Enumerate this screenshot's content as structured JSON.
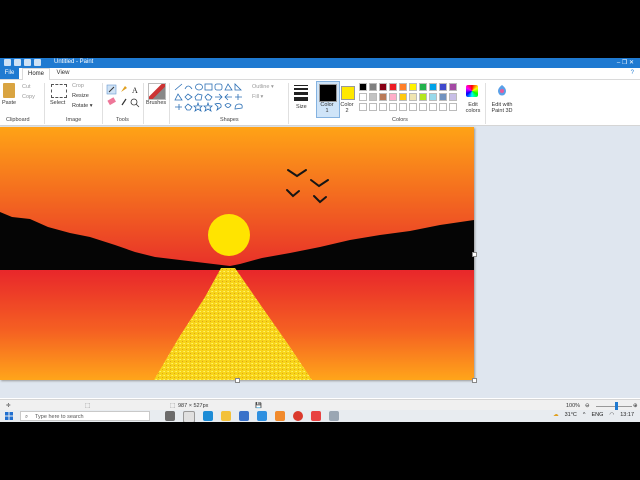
{
  "window": {
    "title": "Untitled - Paint",
    "controls": "–   ❐   ✕"
  },
  "tabs": {
    "file": "File",
    "home": "Home",
    "view": "View"
  },
  "ribbon": {
    "clipboard": {
      "paste": "Paste",
      "cut": "Cut",
      "copy": "Copy",
      "label": "Clipboard"
    },
    "image": {
      "select": "Select",
      "crop": "Crop",
      "resize": "Resize",
      "rotate": "Rotate ▾",
      "label": "Image"
    },
    "tools": {
      "label": "Tools"
    },
    "brushes": {
      "label": "Brushes"
    },
    "shapes": {
      "outline": "Outline ▾",
      "fill": "Fill ▾",
      "label": "Shapes"
    },
    "size": {
      "label": "Size"
    },
    "color1": {
      "label": "Color 1",
      "value": "#000000"
    },
    "color2": {
      "label": "Color 2",
      "value": "#ffe800"
    },
    "colors": {
      "label": "Colors",
      "edit": "Edit colors",
      "paint3d": "Edit with Paint 3D"
    },
    "palette": [
      "#000000",
      "#7f7f7f",
      "#880015",
      "#ed1c24",
      "#ff7f27",
      "#fff200",
      "#22b14c",
      "#00a2e8",
      "#3f48cc",
      "#a349a4",
      "#ffffff",
      "#c3c3c3",
      "#b97a57",
      "#ffaec9",
      "#ffc90e",
      "#efe4b0",
      "#b5e61d",
      "#99d9ea",
      "#7092be",
      "#c8bfe7",
      "#ffffff",
      "#ffffff",
      "#ffffff",
      "#ffffff",
      "#ffffff",
      "#ffffff",
      "#ffffff",
      "#ffffff",
      "#ffffff",
      "#ffffff"
    ]
  },
  "status": {
    "size": "987 × 527px",
    "zoom": "100%"
  },
  "taskbar": {
    "search_placeholder": "Type here to search",
    "weather": "31°C",
    "lang": "ENG",
    "time": "13:17"
  }
}
